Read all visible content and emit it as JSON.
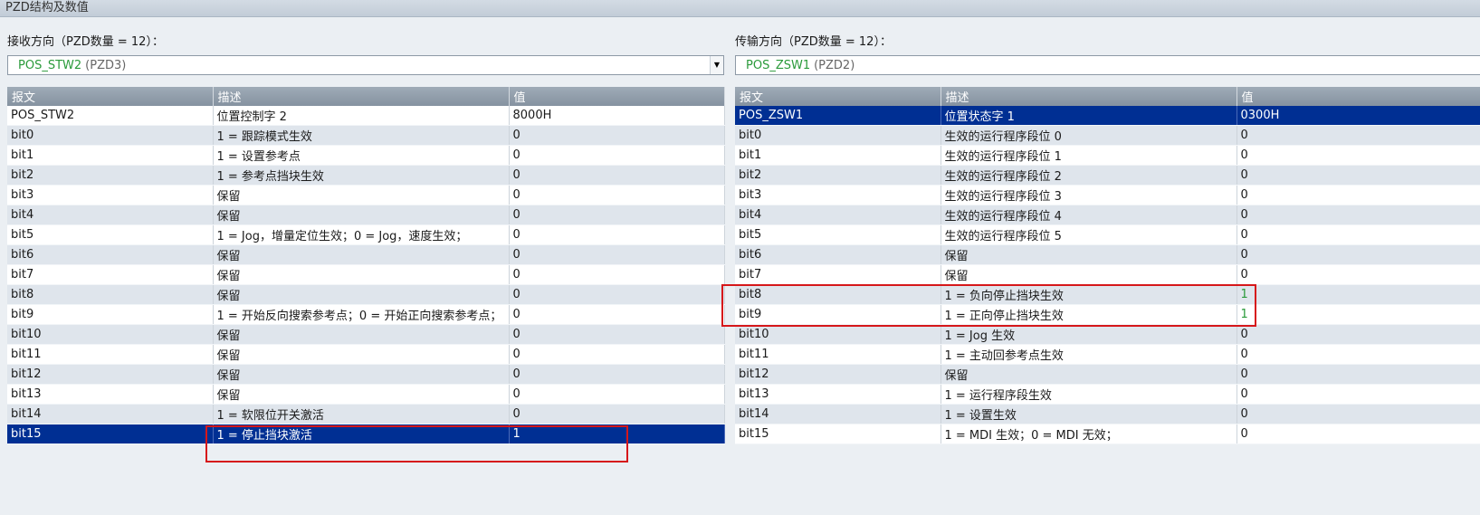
{
  "window": {
    "title": "PZD结构及数值"
  },
  "left": {
    "direction_label": "接收方向（PZD数量 = 12）：",
    "select": {
      "name": "POS_STW2",
      "pzd": "(PZD3)"
    },
    "headers": [
      "报文",
      "描述",
      "值"
    ],
    "rows": [
      [
        "POS_STW2",
        "位置控制字 2",
        "8000H"
      ],
      [
        "bit0",
        "1 = 跟踪模式生效",
        "0"
      ],
      [
        "bit1",
        "1 = 设置参考点",
        "0"
      ],
      [
        "bit2",
        "1 = 参考点挡块生效",
        "0"
      ],
      [
        "bit3",
        "保留",
        "0"
      ],
      [
        "bit4",
        "保留",
        "0"
      ],
      [
        "bit5",
        "1 = Jog，增量定位生效；0 = Jog，速度生效；",
        "0"
      ],
      [
        "bit6",
        "保留",
        "0"
      ],
      [
        "bit7",
        "保留",
        "0"
      ],
      [
        "bit8",
        "保留",
        "0"
      ],
      [
        "bit9",
        "1 = 开始反向搜索参考点；0 = 开始正向搜索参考点；",
        "0"
      ],
      [
        "bit10",
        "保留",
        "0"
      ],
      [
        "bit11",
        "保留",
        "0"
      ],
      [
        "bit12",
        "保留",
        "0"
      ],
      [
        "bit13",
        "保留",
        "0"
      ],
      [
        "bit14",
        "1 = 软限位开关激活",
        "0"
      ],
      [
        "bit15",
        "1 = 停止挡块激活",
        "1"
      ]
    ],
    "selected_row": 16
  },
  "right": {
    "direction_label": "传输方向（PZD数量 = 12）：",
    "select": {
      "name": "POS_ZSW1",
      "pzd": "(PZD2)"
    },
    "headers": [
      "报文",
      "描述",
      "值"
    ],
    "rows": [
      [
        "POS_ZSW1",
        "位置状态字 1",
        "0300H"
      ],
      [
        "bit0",
        "生效的运行程序段位 0",
        "0"
      ],
      [
        "bit1",
        "生效的运行程序段位 1",
        "0"
      ],
      [
        "bit2",
        "生效的运行程序段位 2",
        "0"
      ],
      [
        "bit3",
        "生效的运行程序段位 3",
        "0"
      ],
      [
        "bit4",
        "生效的运行程序段位 4",
        "0"
      ],
      [
        "bit5",
        "生效的运行程序段位 5",
        "0"
      ],
      [
        "bit6",
        "保留",
        "0"
      ],
      [
        "bit7",
        "保留",
        "0"
      ],
      [
        "bit8",
        "1 = 负向停止挡块生效",
        "1"
      ],
      [
        "bit9",
        "1 = 正向停止挡块生效",
        "1"
      ],
      [
        "bit10",
        "1 = Jog 生效",
        "0"
      ],
      [
        "bit11",
        "1 = 主动回参考点生效",
        "0"
      ],
      [
        "bit12",
        "保留",
        "0"
      ],
      [
        "bit13",
        "1 = 运行程序段生效",
        "0"
      ],
      [
        "bit14",
        "1 = 设置生效",
        "0"
      ],
      [
        "bit15",
        "1 = MDI 生效；0 = MDI 无效；",
        "0"
      ]
    ],
    "selected_row": 0,
    "green_value_rows": [
      9,
      10
    ]
  },
  "colors": {
    "selected_row_bg": "#002f93",
    "header_bg": "#8f9baa",
    "highlight_box": "#d6171a",
    "select_text": "#2a9a3a"
  }
}
